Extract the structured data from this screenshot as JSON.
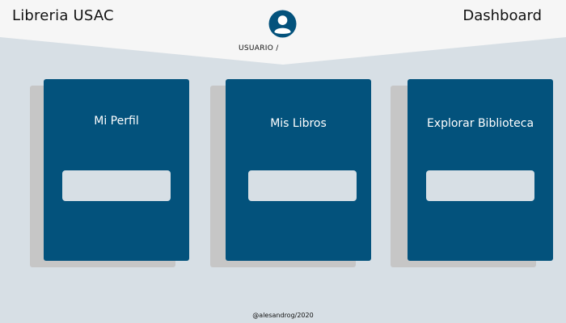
{
  "header": {
    "app_title": "Libreria USAC",
    "page_heading": "Dashboard",
    "user_label": "USUARIO /",
    "avatar_icon": "user-avatar-icon"
  },
  "cards": [
    {
      "title": "Mi Perfil",
      "button_label": ""
    },
    {
      "title": "Mis Libros",
      "button_label": ""
    },
    {
      "title": "Explorar Biblioteca",
      "button_label": ""
    }
  ],
  "footer": {
    "text": "@alesandrog/2020"
  },
  "colors": {
    "background": "#d7dfe5",
    "header": "#f6f6f6",
    "card": "#03527c",
    "card_shadow": "#c6c6c6",
    "button": "#d7dfe5"
  }
}
